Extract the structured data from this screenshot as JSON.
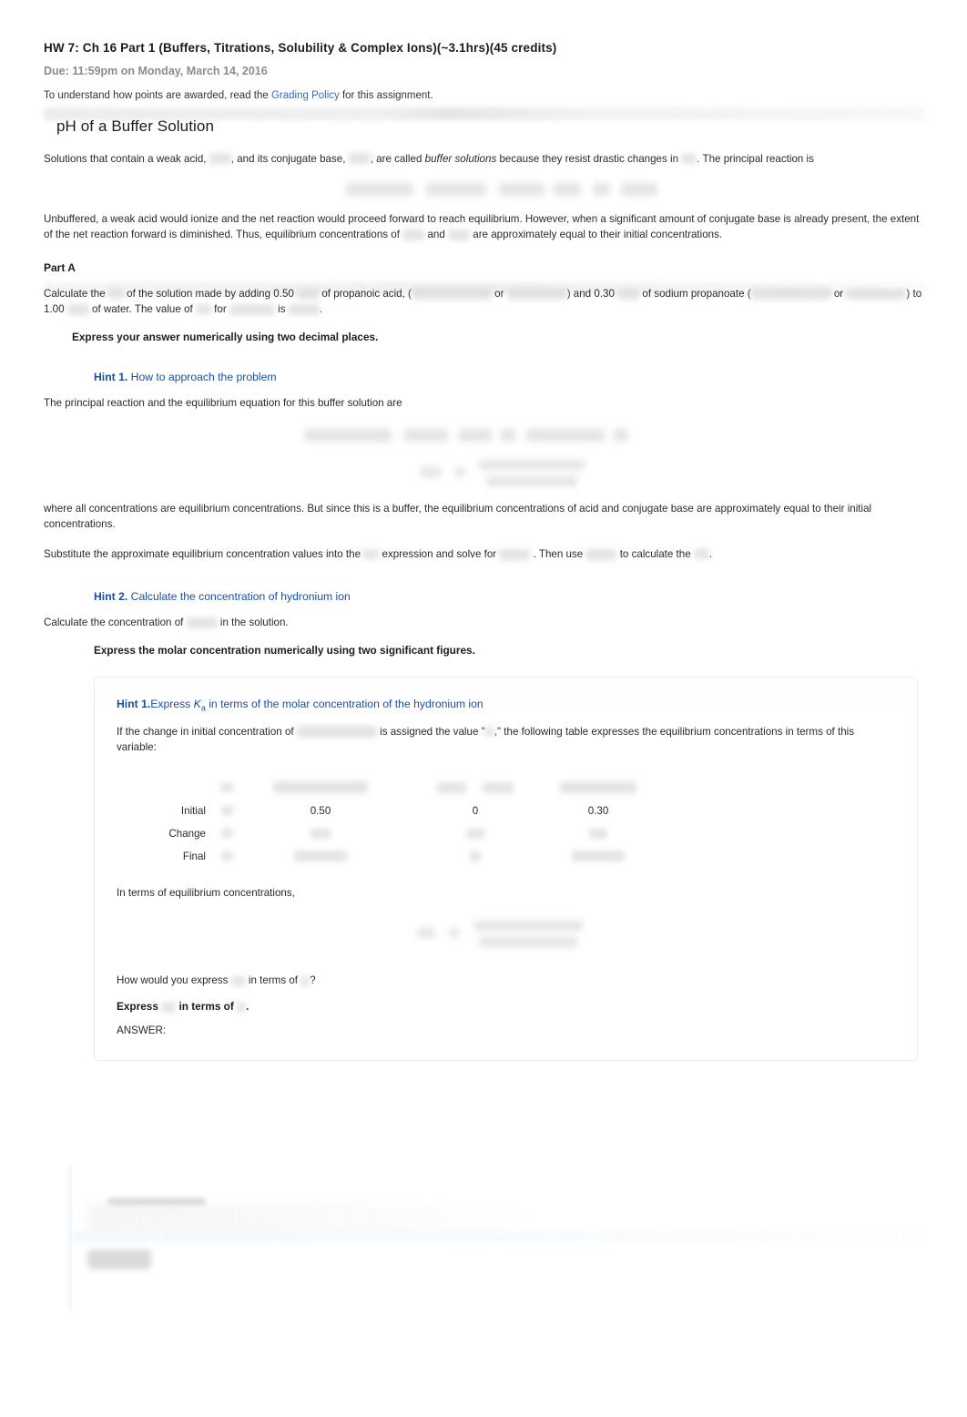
{
  "header": {
    "assignment_title": "HW 7: Ch 16 Part 1 (Buffers, Titrations, Solubility & Complex Ions)(~3.1hrs)(45 credits)",
    "due_text": "Due: 11:59pm on Monday, March 14, 2016",
    "policy_prefix": "To understand how points are awarded, read the ",
    "policy_link": "Grading Policy",
    "policy_suffix": " for this assignment."
  },
  "section": {
    "title": "pH of a Buffer Solution",
    "intro_1a": "Solutions that contain a weak acid,",
    "intro_1b": ", and its conjugate base,",
    "intro_1c": ", are called ",
    "intro_1d": "buffer solutions",
    "intro_1e": " because they resist drastic changes in ",
    "intro_1f": ". The principal reaction is",
    "intro_2a": "Unbuffered, a weak acid would ionize and the net reaction would proceed forward to reach equilibrium. However, when a significant amount of conjugate base is already present, the extent of the net reaction forward is diminished. Thus, equilibrium concentrations of",
    "intro_2b": "and",
    "intro_2c": "are approximately equal to their initial concentrations."
  },
  "part_a": {
    "label": "Part A",
    "q_1": "Calculate the",
    "q_2": "of the solution made by adding 0.50",
    "q_3": "of propanoic acid, (",
    "q_4": "or",
    "q_5": ") and 0.30",
    "q_6": "of sodium propanoate (",
    "q_7": "or",
    "q_8": ") to 1.00",
    "q_9": "of water. The value of",
    "q_10": "for",
    "q_11": "is",
    "q_12": ".",
    "instruction": "Express your answer numerically using two decimal places."
  },
  "hint1": {
    "num": "Hint 1.",
    "title": "How to approach the problem",
    "line_1": "The principal reaction and the equilibrium equation for this buffer solution are",
    "line_2": "where all concentrations are equilibrium concentrations. But since this is a buffer, the equilibrium concentrations of acid and conjugate base are approximately equal to their initial concentrations.",
    "line_3a": "Substitute the approximate equilibrium concentration values into the",
    "line_3b": "expression and solve for",
    "line_3c": ". Then use",
    "line_3d": "to calculate the",
    "line_3e": "."
  },
  "hint2": {
    "num": "Hint 2.",
    "title": "Calculate the concentration of hydronium ion",
    "line_1a": "Calculate the concentration of",
    "line_1b": "in the solution.",
    "instruction": "Express the molar concentration numerically using two significant figures."
  },
  "nested_hint": {
    "num": "Hint 1.",
    "title_a": "Express ",
    "title_k": "K",
    "title_sub": "a",
    "title_b": " in terms of the molar concentration of the hydronium ion",
    "line_1a": "If the change in initial concentration of",
    "line_1b": "is assigned the value \"",
    "line_1c": ",\" the following table expresses the equilibrium concentrations in terms of this variable:",
    "line_2": "In terms of equilibrium concentrations,",
    "line_3a": "How would you express",
    "line_3b": "in terms of",
    "line_3c": "?",
    "line_4a": "Express",
    "line_4b": "in terms of",
    "line_4c": ".",
    "answer_label": "ANSWER:"
  },
  "ice_table": {
    "row_labels": [
      "Initial",
      "Change",
      "Final"
    ],
    "initial_values": [
      "0.50",
      "0",
      "0.30"
    ],
    "change_values": [
      "",
      "",
      ""
    ],
    "final_values": [
      "",
      "",
      ""
    ]
  },
  "colors": {
    "hint_blue": "#1c4fa0",
    "link_blue": "#2f6cc4",
    "text": "#2a2a2a",
    "due_gray": "#8c8c8c",
    "placeholder_gray": "#d9d9d9"
  }
}
